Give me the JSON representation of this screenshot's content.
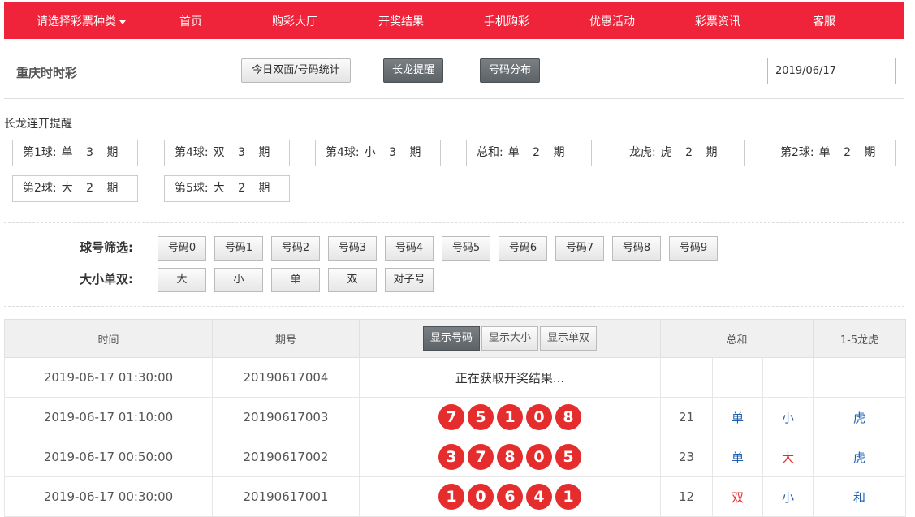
{
  "nav": {
    "lottery_select": "请选择彩票种类",
    "items": [
      "首页",
      "购彩大厅",
      "开奖结果",
      "手机购彩",
      "优惠活动",
      "彩票资讯",
      "客服"
    ]
  },
  "header": {
    "title": "重庆时时彩",
    "btn_stats": "今日双面/号码统计",
    "btn_long": "长龙提醒",
    "btn_dist": "号码分布",
    "date": "2019/06/17"
  },
  "reminder": {
    "title": "长龙连开提醒",
    "items": [
      {
        "label": "第1球:",
        "value": "单 3 期"
      },
      {
        "label": "第4球:",
        "value": "双 3 期"
      },
      {
        "label": "第4球:",
        "value": "小 3 期"
      },
      {
        "label": "总和:",
        "value": "单 2 期"
      },
      {
        "label": "龙虎:",
        "value": "虎 2 期"
      },
      {
        "label": "第2球:",
        "value": "单 2 期"
      },
      {
        "label": "第2球:",
        "value": "大 2 期"
      },
      {
        "label": "第5球:",
        "value": "大 2 期"
      }
    ]
  },
  "filters": {
    "ball_label": "球号筛选:",
    "ball_options": [
      "号码0",
      "号码1",
      "号码2",
      "号码3",
      "号码4",
      "号码5",
      "号码6",
      "号码7",
      "号码8",
      "号码9"
    ],
    "size_label": "大小单双:",
    "size_options": [
      "大",
      "小",
      "单",
      "双",
      "对子号"
    ]
  },
  "table": {
    "headers": {
      "time": "时间",
      "period": "期号",
      "sum": "总和",
      "dragon": "1-5龙虎"
    },
    "display_buttons": [
      "显示号码",
      "显示大小",
      "显示单双"
    ],
    "rows": [
      {
        "time": "2019-06-17 01:30:00",
        "period": "20190617004",
        "pending": "正在获取开奖结果...",
        "balls": [],
        "sum": "",
        "odd_even": "",
        "size": "",
        "dragon": ""
      },
      {
        "time": "2019-06-17 01:10:00",
        "period": "20190617003",
        "pending": "",
        "balls": [
          "7",
          "5",
          "1",
          "0",
          "8"
        ],
        "sum": "21",
        "odd_even": "单",
        "size": "小",
        "dragon": "虎"
      },
      {
        "time": "2019-06-17 00:50:00",
        "period": "20190617002",
        "pending": "",
        "balls": [
          "3",
          "7",
          "8",
          "0",
          "5"
        ],
        "sum": "23",
        "odd_even": "单",
        "size": "大",
        "dragon": "虎"
      },
      {
        "time": "2019-06-17 00:30:00",
        "period": "20190617001",
        "pending": "",
        "balls": [
          "1",
          "0",
          "6",
          "4",
          "1"
        ],
        "sum": "12",
        "odd_even": "双",
        "size": "小",
        "dragon": "和"
      }
    ]
  },
  "colors": {
    "nav_bg": "#ef2339",
    "ball": "#e62d2d",
    "blue_text": "#1e5fb3",
    "red_text": "#e62d2d"
  }
}
